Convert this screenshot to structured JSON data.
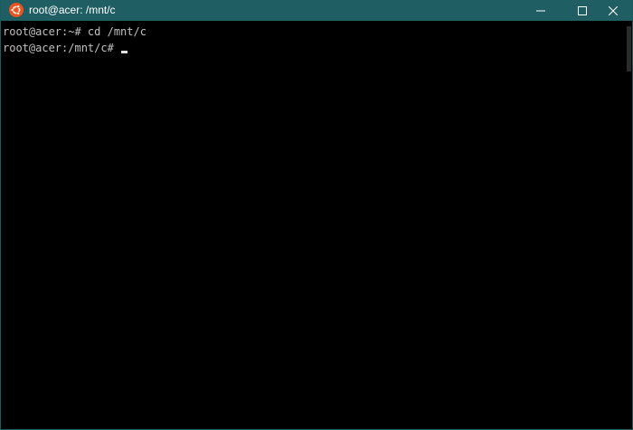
{
  "window": {
    "title": "root@acer: /mnt/c",
    "titlebar_color": "#1f5e63",
    "app_icon": "ubuntu-icon"
  },
  "controls": {
    "minimize_icon": "minimize-icon",
    "maximize_icon": "maximize-icon",
    "close_icon": "close-icon"
  },
  "terminal": {
    "lines": [
      {
        "prompt": "root@acer:~#",
        "command": " cd /mnt/c"
      },
      {
        "prompt": "root@acer:/mnt/c#",
        "command": ""
      }
    ],
    "text_color": "#c0c0c0",
    "background": "#000000"
  }
}
